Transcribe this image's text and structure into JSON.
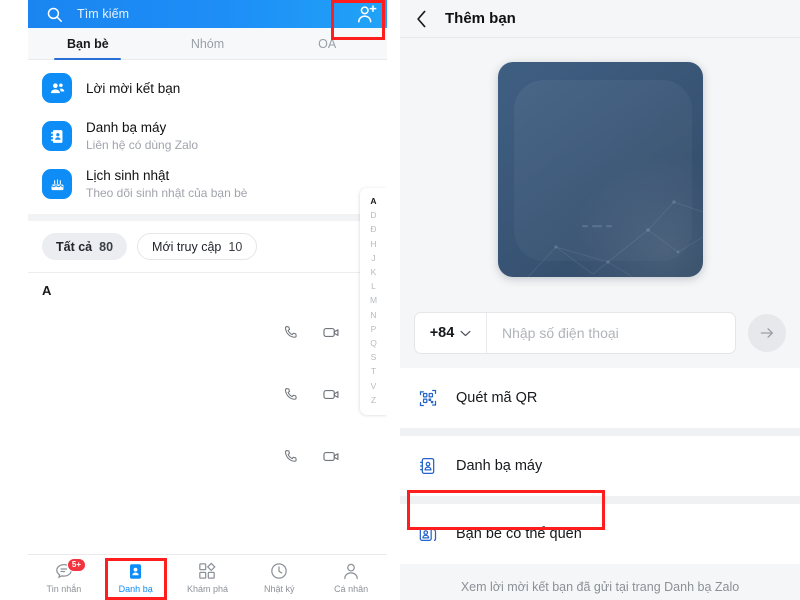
{
  "left": {
    "search": {
      "placeholder": "Tìm kiếm",
      "icon": "search-icon"
    },
    "add_friend_icon": "add-friend-icon",
    "tabs": [
      {
        "label": "Bạn bè",
        "active": true
      },
      {
        "label": "Nhóm",
        "active": false
      },
      {
        "label": "OA",
        "active": false
      }
    ],
    "menu": [
      {
        "title": "Lời mời kết bạn",
        "sub": "",
        "icon": "friend-requests-icon"
      },
      {
        "title": "Danh bạ máy",
        "sub": "Liên hệ có dùng Zalo",
        "icon": "phonebook-icon"
      },
      {
        "title": "Lịch sinh nhật",
        "sub": "Theo dõi sinh nhật của bạn bè",
        "icon": "birthday-cake-icon"
      }
    ],
    "filters": [
      {
        "label": "Tất cả",
        "count": "80",
        "selected": true
      },
      {
        "label": "Mới truy cập",
        "count": "10",
        "selected": false
      }
    ],
    "section_letter": "A",
    "contacts": [
      {
        "name": "",
        "call_icon": "phone-call-icon",
        "video_icon": "video-call-icon"
      },
      {
        "name": "",
        "call_icon": "phone-call-icon",
        "video_icon": "video-call-icon"
      },
      {
        "name": "",
        "call_icon": "phone-call-icon",
        "video_icon": "video-call-icon"
      }
    ],
    "alpha_index": [
      "A",
      "D",
      "Đ",
      "H",
      "J",
      "K",
      "L",
      "M",
      "N",
      "P",
      "Q",
      "S",
      "T",
      "V",
      "Z"
    ],
    "alpha_current": "A",
    "bottom_nav": [
      {
        "label": "Tin nhắn",
        "icon": "chat-bubble-icon",
        "badge": "5+",
        "active": false
      },
      {
        "label": "Danh bạ",
        "icon": "contacts-icon",
        "badge": "",
        "active": true
      },
      {
        "label": "Khám phá",
        "icon": "discover-icon",
        "badge": "",
        "active": false
      },
      {
        "label": "Nhật ký",
        "icon": "timeline-clock-icon",
        "badge": "",
        "active": false
      },
      {
        "label": "Cá nhân",
        "icon": "person-icon",
        "badge": "",
        "active": false
      }
    ]
  },
  "right": {
    "header": {
      "back_icon": "back-chevron-icon",
      "title": "Thêm bạn"
    },
    "qr_card": {
      "alt": "blurred-qr-code-card"
    },
    "phone": {
      "country_code": "+84",
      "chevron": "chevron-down-icon",
      "placeholder": "Nhập số điện thoại",
      "value": "",
      "submit_icon": "arrow-right-icon"
    },
    "options": [
      {
        "label": "Quét mã QR",
        "icon": "qr-scan-icon",
        "highlighted": false
      },
      {
        "label": "Danh bạ máy",
        "icon": "phonebook-icon",
        "highlighted": false
      },
      {
        "label": "Bạn bè có thể quen",
        "icon": "people-you-may-know-icon",
        "highlighted": true
      }
    ],
    "footnote": "Xem lời mời kết bạn đã gửi tại trang Danh bạ Zalo"
  },
  "annotations": {
    "highlight_color": "#fe1e1e",
    "boxes": [
      "add-friend-button",
      "bottom-nav-contacts",
      "people-you-may-know-row"
    ]
  },
  "colors": {
    "brand_blue": "#0d8df5",
    "header_gradient_start": "#1a85f0",
    "header_gradient_end": "#20a3f7",
    "badge_red": "#f5333f",
    "highlight_red": "#fe1e1e",
    "right_bg": "#f5f6f7"
  }
}
